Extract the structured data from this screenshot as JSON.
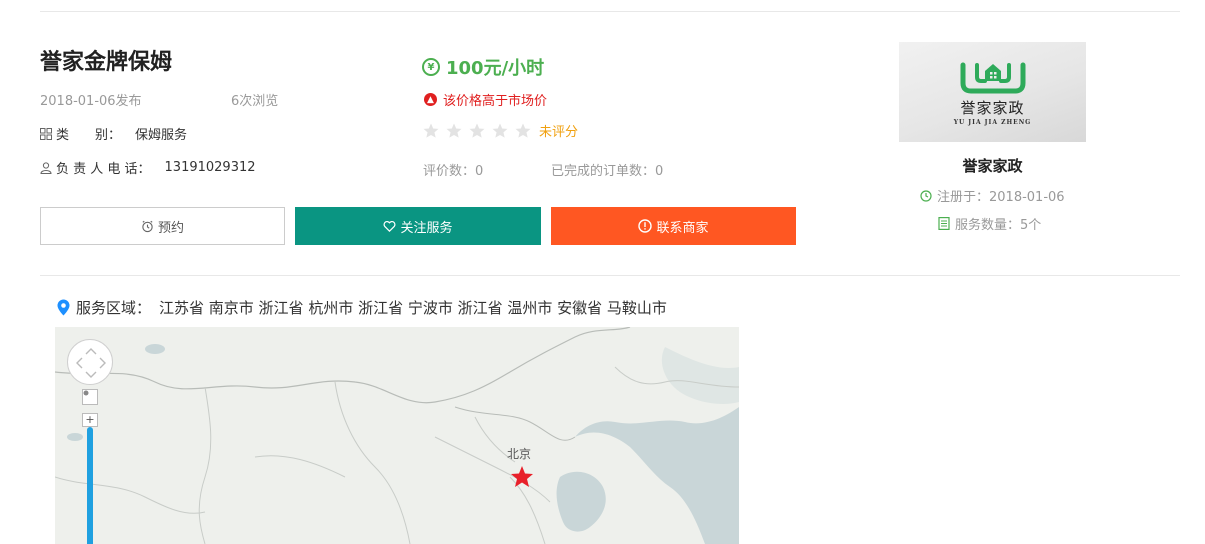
{
  "listing": {
    "title": "誉家金牌保姆",
    "publish_date": "2018-01-06发布",
    "views": "6次浏览",
    "category_label": "类　　别：",
    "category_value": "保姆服务",
    "phone_label": "负 责 人 电 话：",
    "phone_value": "13191029312"
  },
  "pricing": {
    "currency_icon": "yen-icon",
    "price": "100元/小时",
    "warning": "该价格高于市场价",
    "rating_text": "未评分",
    "stars_filled": 0,
    "stars_total": 5,
    "review_count": "评价数：0",
    "completed_orders": "已完成的订单数：0"
  },
  "actions": {
    "book_label": "预约",
    "follow_label": "关注服务",
    "contact_label": "联系商家"
  },
  "merchant": {
    "logo_cn": "誉家家政",
    "logo_en": "YU JIA JIA ZHENG",
    "name": "誉家家政",
    "registered": "注册于：2018-01-06",
    "service_count": "服务数量：5个"
  },
  "service_area": {
    "label": "服务区域：",
    "value": "江苏省 南京市 浙江省 杭州市 浙江省 宁波市 浙江省 温州市 安徽省 马鞍山市"
  },
  "map": {
    "city_label": "北京"
  },
  "colors": {
    "green": "#4caf50",
    "teal": "#0a9582",
    "orange": "#ff5722",
    "red": "#e02020",
    "star_empty": "#e3e3e3",
    "unrated": "#f0a010"
  }
}
